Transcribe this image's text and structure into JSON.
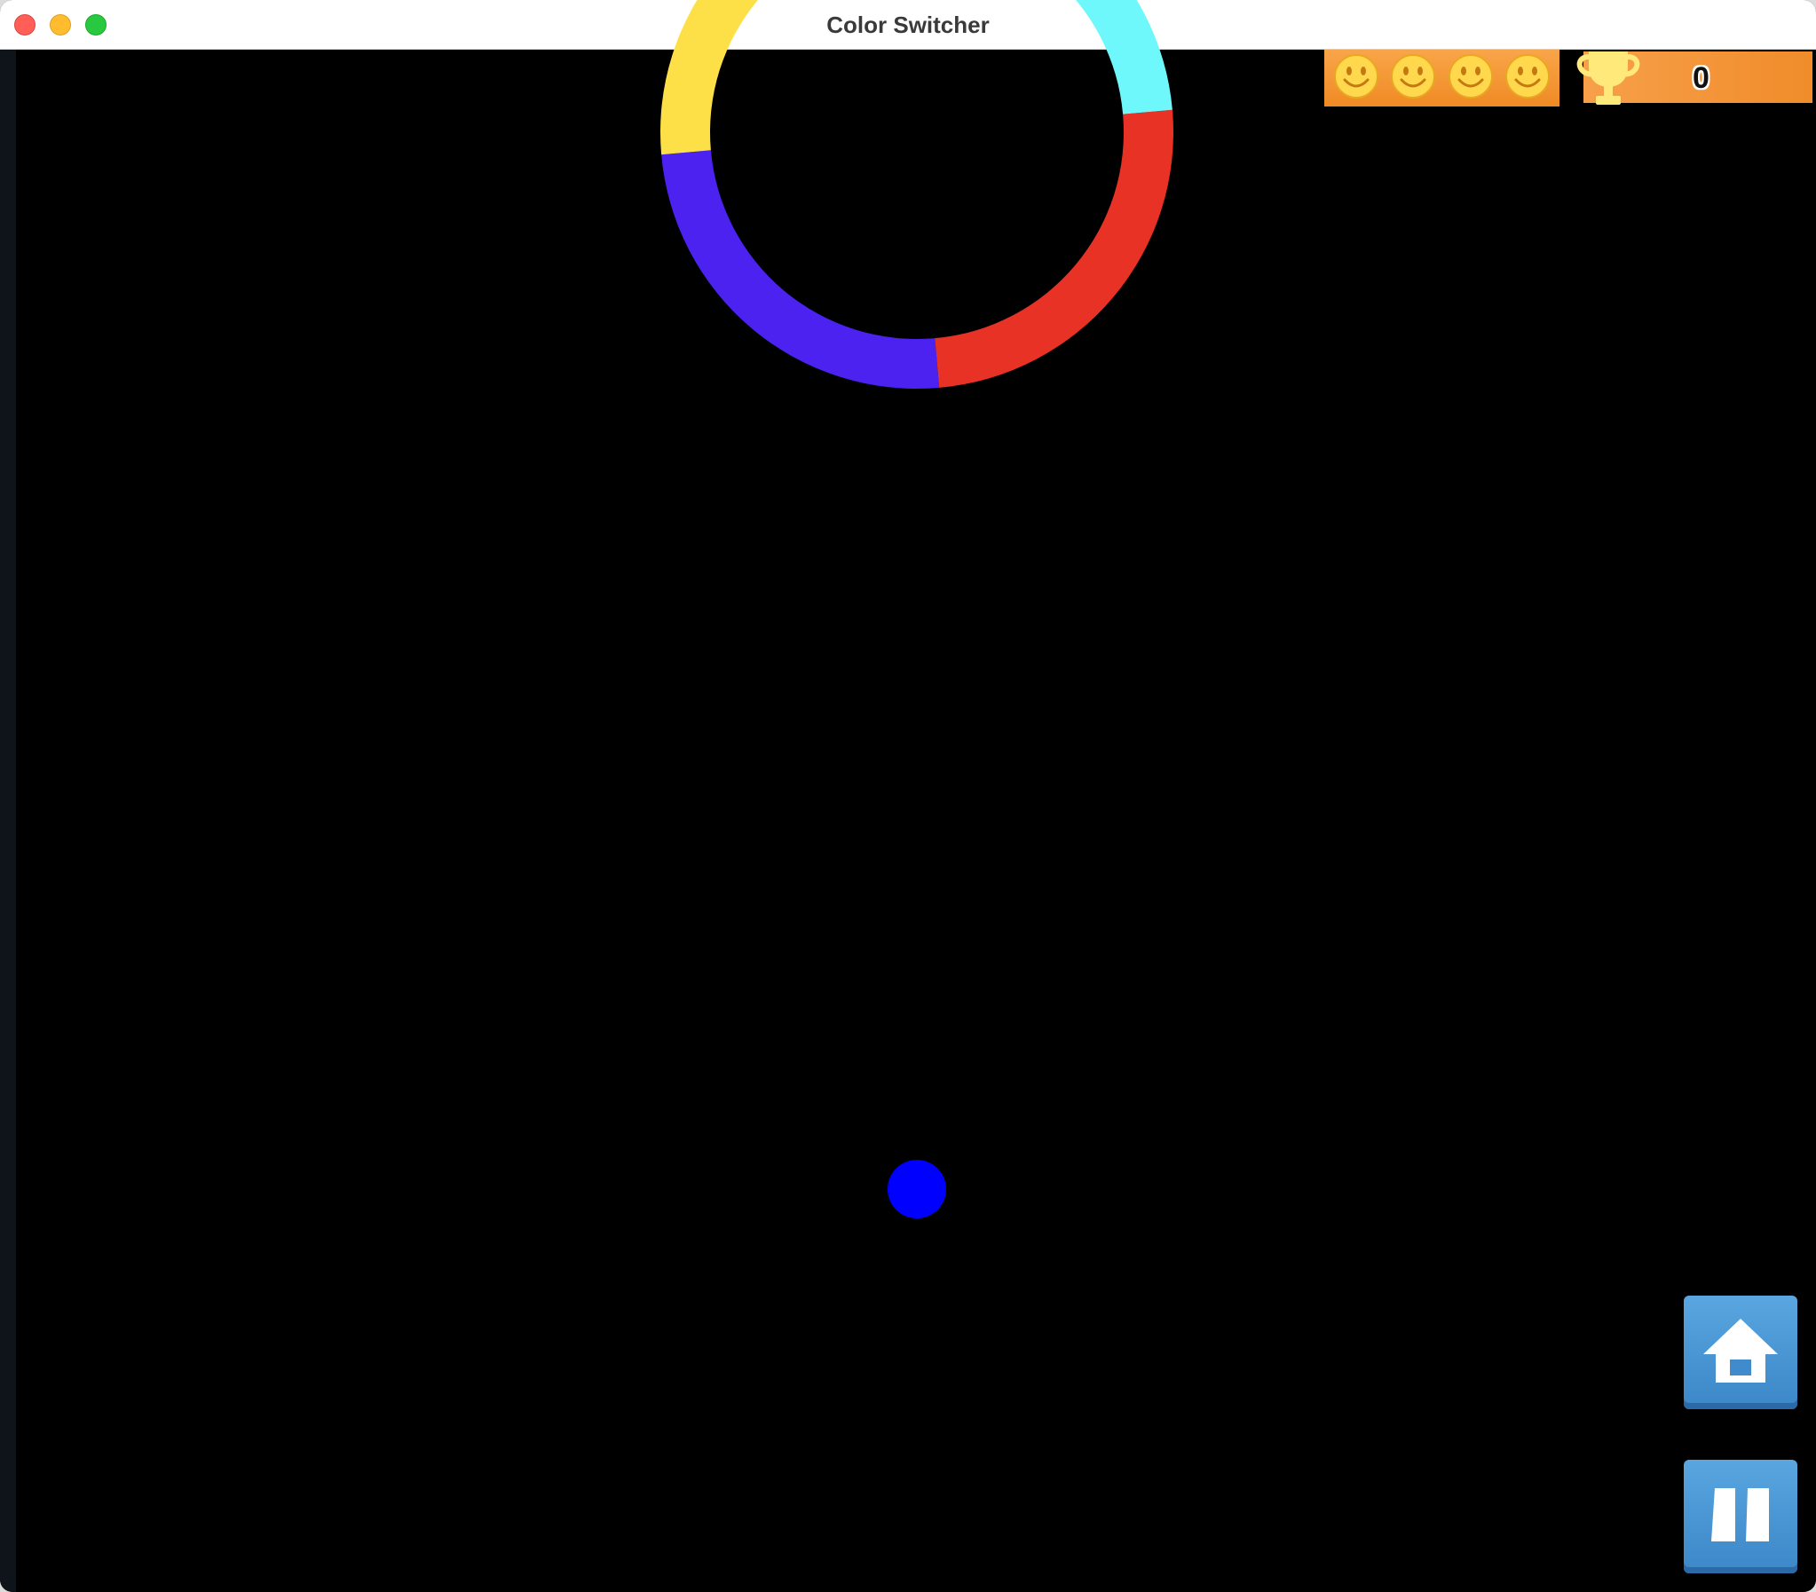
{
  "window": {
    "title": "Color Switcher"
  },
  "hud": {
    "lives": 4,
    "score": "0"
  },
  "ring_colors": [
    "#4b22f0",
    "#e83225",
    "#6ff8fb",
    "#fde047"
  ],
  "ball_color": "#0000ff",
  "colors": {
    "hud_orange": "#f39232",
    "trophy": "#ffe97a",
    "button_blue": "#4a98d6"
  },
  "icons": {
    "life": "smiley-face-icon",
    "score": "trophy-icon",
    "home": "home-icon",
    "pause": "pause-icon"
  }
}
